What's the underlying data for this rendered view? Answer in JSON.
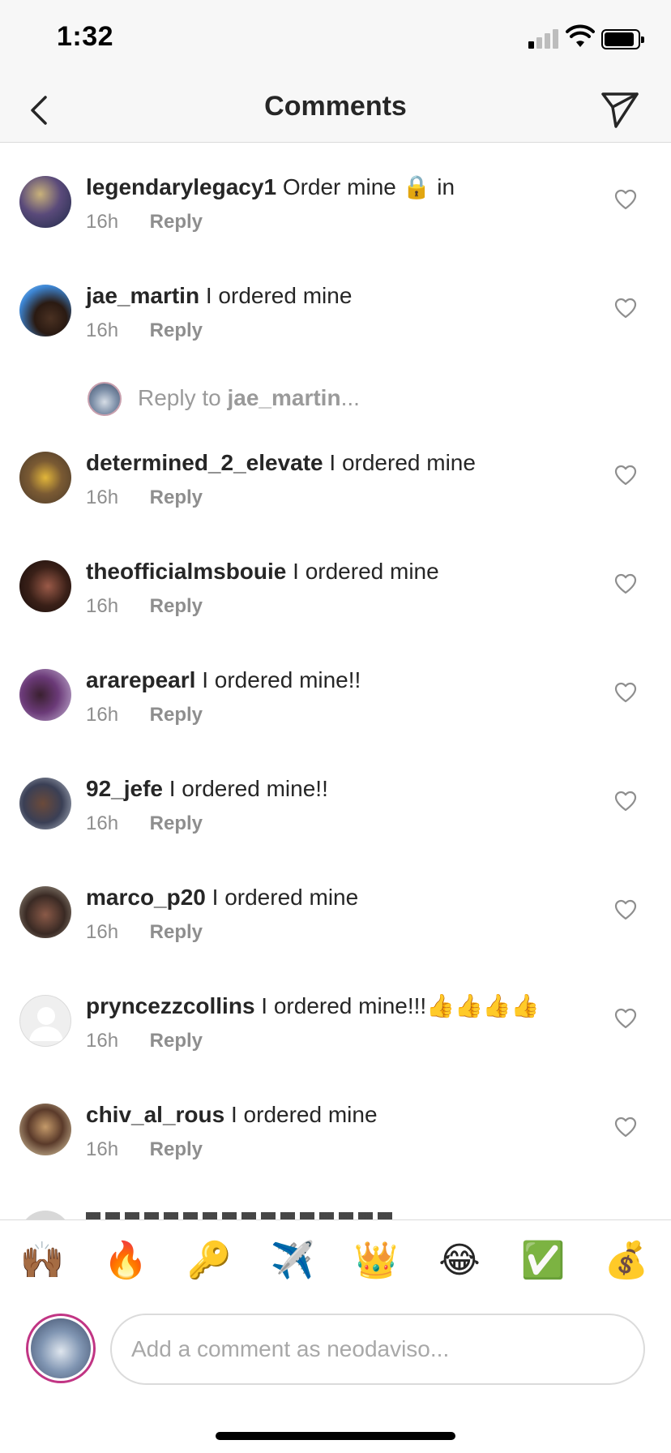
{
  "status_bar": {
    "time": "1:32"
  },
  "header": {
    "title": "Comments",
    "back_icon": "chevron-left-icon",
    "send_icon": "paper-plane-icon"
  },
  "comments": [
    {
      "username": "legendarylegacy1",
      "text_before": "Order mine ",
      "emoji": "🔒",
      "text_after": " in",
      "time": "16h",
      "reply_label": "Reply",
      "avatar_color": "#3a4a6b"
    },
    {
      "username": "jae_martin",
      "text": "I ordered mine",
      "time": "16h",
      "reply_label": "Reply",
      "avatar_color": "#2e6db3"
    },
    {
      "username": "determined_2_elevate",
      "text": "I ordered mine",
      "time": "16h",
      "reply_label": "Reply",
      "avatar_color": "#8b6a3c"
    },
    {
      "username": "theofficialmsbouie",
      "text": "I ordered mine",
      "time": "16h",
      "reply_label": "Reply",
      "avatar_color": "#3a2620"
    },
    {
      "username": "ararepearl",
      "text": "I ordered mine!!",
      "time": "16h",
      "reply_label": "Reply",
      "avatar_color": "#6b4a78"
    },
    {
      "username": "92_jefe",
      "text": "I ordered mine!!",
      "time": "16h",
      "reply_label": "Reply",
      "avatar_color": "#5b5d6a"
    },
    {
      "username": "marco_p20",
      "text": "I ordered mine",
      "time": "16h",
      "reply_label": "Reply",
      "avatar_color": "#4a3b33"
    },
    {
      "username": "pryncezzcollins",
      "text": "I ordered mine!!!👍👍👍👍",
      "time": "16h",
      "reply_label": "Reply",
      "avatar_color": "#dbdbdb"
    },
    {
      "username": "chiv_al_rous",
      "text": "I ordered mine",
      "time": "16h",
      "reply_label": "Reply",
      "avatar_color": "#6b4a3a"
    }
  ],
  "reply_prompt": {
    "prefix": "Reply to ",
    "username": "jae_martin",
    "suffix": "..."
  },
  "emoji_bar": [
    "🙌🏾",
    "🔥",
    "🔑",
    "✈️",
    "👑",
    "😂",
    "✅",
    "💰"
  ],
  "composer": {
    "placeholder": "Add a comment as neodaviso..."
  },
  "colors": {
    "text": "#262626",
    "secondary": "#8e8e8e",
    "border": "#dbdbdb",
    "story_ring": "#c13584"
  }
}
